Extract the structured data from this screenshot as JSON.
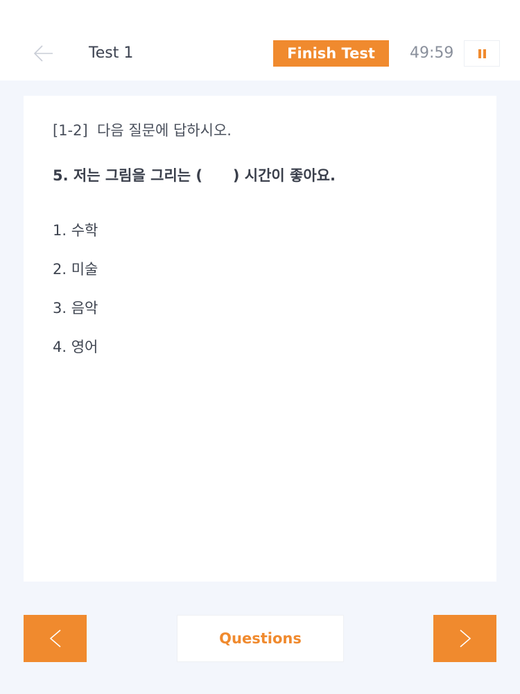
{
  "header": {
    "title": "Test 1",
    "finish_label": "Finish Test",
    "timer": "49:59"
  },
  "question": {
    "instruction": "[1-2]  다음 질문에 답하시오.",
    "text": "5. 저는 그림을 그리는 (      ) 시간이 좋아요.",
    "options": [
      {
        "label": "1. 수학"
      },
      {
        "label": "2. 미술"
      },
      {
        "label": "3. 음악"
      },
      {
        "label": "4. 영어"
      }
    ]
  },
  "footer": {
    "questions_label": "Questions"
  },
  "colors": {
    "accent": "#f08a2e",
    "background": "#f3f6fc",
    "surface": "#ffffff",
    "text_dark": "#3a3f4b",
    "text_muted": "#8a909c"
  },
  "icons": {
    "back": "arrow-left-icon",
    "pause": "pause-icon",
    "prev": "chevron-left-icon",
    "next": "chevron-right-icon"
  }
}
